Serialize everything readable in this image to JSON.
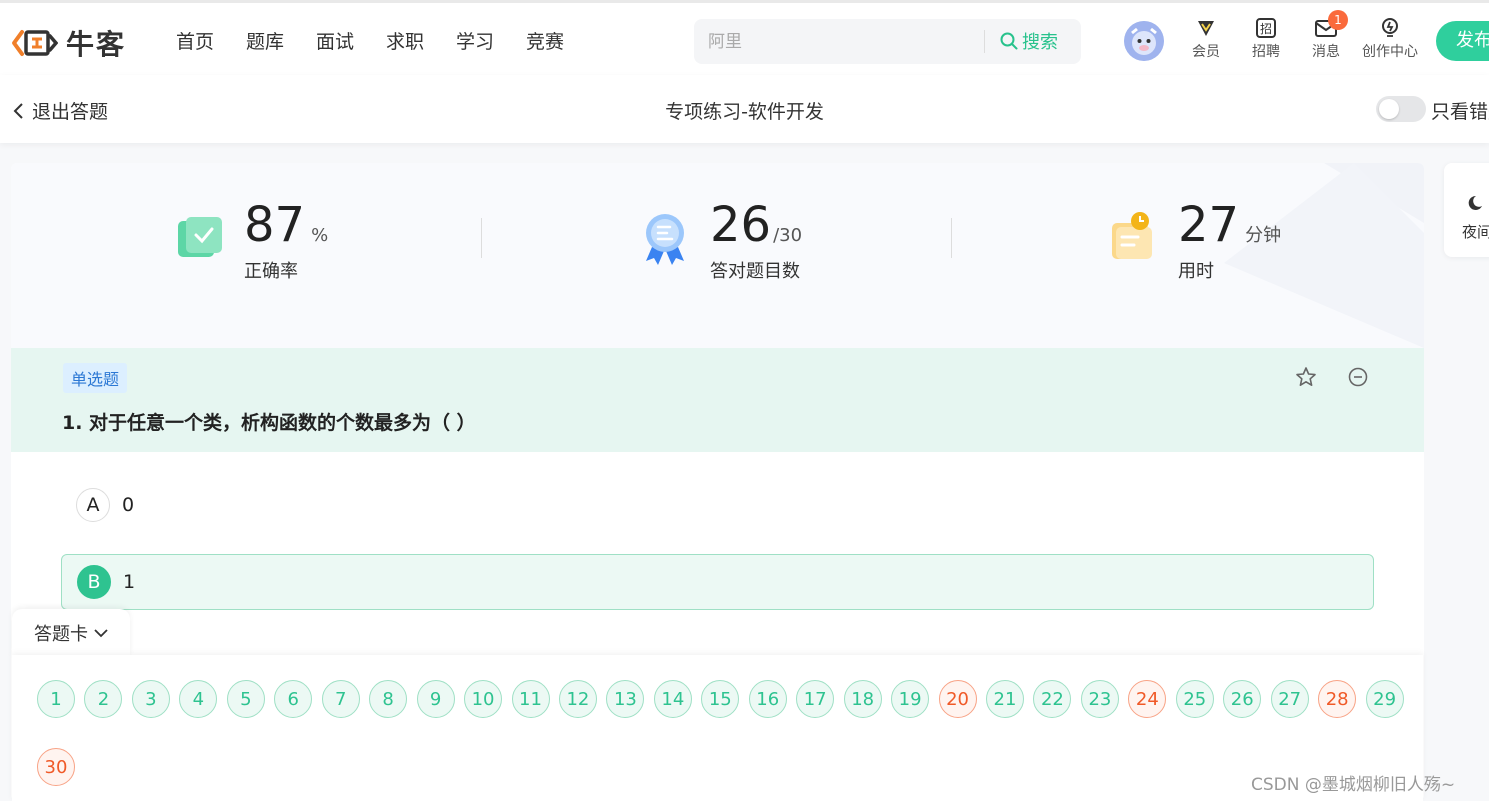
{
  "header": {
    "logo_text": "牛客",
    "nav": [
      "首页",
      "题库",
      "面试",
      "求职",
      "学习",
      "竞赛"
    ],
    "search_placeholder": "阿里",
    "search_button": "搜索",
    "icons": [
      {
        "label": "会员",
        "icon": "vip-icon"
      },
      {
        "label": "招聘",
        "icon": "recruit-icon"
      },
      {
        "label": "消息",
        "icon": "message-icon",
        "badge": "1"
      },
      {
        "label": "创作中心",
        "icon": "bulb-icon"
      }
    ],
    "publish": "发布"
  },
  "subbar": {
    "back": "退出答题",
    "title": "专项练习-软件开发",
    "toggle_label": "只看错题",
    "toggle_on": false
  },
  "stats": [
    {
      "value": "87",
      "unit": "%",
      "label": "正确率"
    },
    {
      "value": "26",
      "unit": "/30",
      "label": "答对题目数"
    },
    {
      "value": "27",
      "unit": "分钟",
      "label": "用时"
    }
  ],
  "question": {
    "type": "单选题",
    "text": "1. 对于任意一个类，析构函数的个数最多为（        ）",
    "options": [
      {
        "letter": "A",
        "value": "0",
        "selected": false
      },
      {
        "letter": "B",
        "value": "1",
        "selected": true
      }
    ]
  },
  "answer_sheet": {
    "label": "答题卡",
    "numbers": [
      "1",
      "2",
      "3",
      "4",
      "5",
      "6",
      "7",
      "8",
      "9",
      "10",
      "11",
      "12",
      "13",
      "14",
      "15",
      "16",
      "17",
      "18",
      "19",
      "20",
      "21",
      "22",
      "23",
      "24",
      "25",
      "26",
      "27",
      "28",
      "29",
      "30"
    ],
    "wrong": [
      "20",
      "24",
      "28",
      "30"
    ]
  },
  "side": {
    "night": "夜间"
  },
  "watermark": "CSDN @墨城烟柳旧人殇~",
  "colors": {
    "accent": "#2ec390",
    "wrong": "#f05a28",
    "question_bg": "#e6f6f1"
  }
}
